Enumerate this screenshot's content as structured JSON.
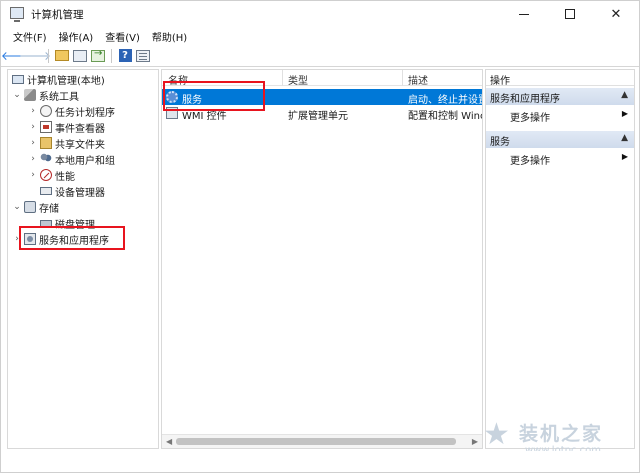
{
  "window": {
    "title": "计算机管理",
    "controls": {
      "minimize": "—",
      "maximize": "☐",
      "close": "✕"
    }
  },
  "menu": [
    {
      "label": "文件(F)"
    },
    {
      "label": "操作(A)"
    },
    {
      "label": "查看(V)"
    },
    {
      "label": "帮助(H)"
    }
  ],
  "toolbar": {
    "back": "🡐",
    "forward": "🡒",
    "help": "?"
  },
  "tree": {
    "root": "计算机管理(本地)",
    "system_tools": "系统工具",
    "task_scheduler": "任务计划程序",
    "event_viewer": "事件查看器",
    "shared_folders": "共享文件夹",
    "local_users": "本地用户和组",
    "performance": "性能",
    "device_manager": "设备管理器",
    "storage": "存储",
    "disk_management": "磁盘管理",
    "services_apps": "服务和应用程序"
  },
  "list": {
    "columns": {
      "name": "名称",
      "type": "类型",
      "desc": "描述"
    },
    "rows": [
      {
        "name": "服务",
        "type": "",
        "desc": "启动、终止并设置"
      },
      {
        "name": "WMI 控件",
        "type": "扩展管理单元",
        "desc": "配置和控制 Winc"
      }
    ]
  },
  "actions": {
    "header": "操作",
    "group1": "服务和应用程序",
    "group1_more": "更多操作",
    "group2": "服务",
    "group2_more": "更多操作"
  },
  "watermark": {
    "text": "装机之家",
    "url": "www.lotpc.com"
  },
  "colors": {
    "selection": "#0078d7",
    "highlight": "#e8141e"
  }
}
